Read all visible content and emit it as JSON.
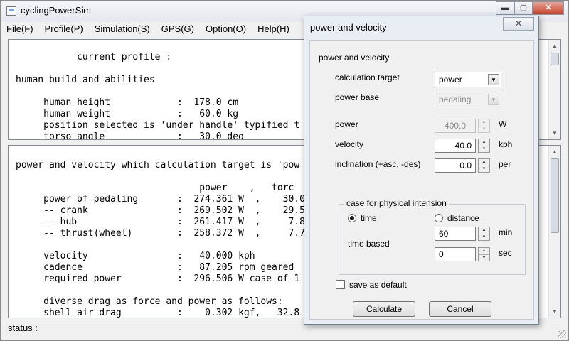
{
  "window": {
    "title": "cyclingPowerSim",
    "minimize": "▬",
    "maximize": "▢",
    "close": "✕"
  },
  "menu": [
    "File(F)",
    "Profile(P)",
    "Simulation(S)",
    "GPS(G)",
    "Option(O)",
    "Help(H)"
  ],
  "top_pane_lines": [
    "           current profile :",
    "",
    "human build and abilities",
    "",
    "     human height            :  178.0 cm",
    "     human weight            :   60.0 kg",
    "     position selected is 'under handle' typified t",
    "     torso angle             :   30.0 deg"
  ],
  "bottom_pane_lines": [
    "power and velocity which calculation target is 'pow",
    "",
    "                                 power    ,   torc",
    "     power of pedaling       :  274.361 W  ,    30.0",
    "     -- crank                :  269.502 W  ,    29.5",
    "     -- hub                  :  261.417 W  ,     7.8",
    "     -- thrust(wheel)        :  258.372 W  ,     7.7",
    "",
    "     velocity                :   40.000 kph",
    "     cadence                 :   87.205 rpm geared",
    "     required power          :  296.506 W case of 1",
    "",
    "     diverse drag as force and power as follows:",
    "     shell air drag          :    0.302 kgf,   32.8"
  ],
  "status": "status :",
  "dialog": {
    "title": "power and velocity",
    "close": "✕",
    "section": "power and velocity",
    "calc_target_label": "calculation target",
    "calc_target_value": "power",
    "power_base_label": "power base",
    "power_base_value": "pedaling",
    "power_label": "power",
    "power_value": "400.0",
    "power_unit": "W",
    "velocity_label": "velocity",
    "velocity_value": "40.0",
    "velocity_unit": "kph",
    "inclination_label": "inclination (+asc, -des)",
    "inclination_value": "0.0",
    "inclination_unit": "per",
    "group_title": "case for physical intension",
    "radio_time": "time",
    "radio_distance": "distance",
    "time_based_label": "time based",
    "min_value": "60",
    "min_unit": "min",
    "sec_value": "0",
    "sec_unit": "sec",
    "save_default_label": "save as default",
    "calculate_label": "Calculate",
    "cancel_label": "Cancel"
  },
  "icons": {
    "up": "▲",
    "down": "▼"
  }
}
